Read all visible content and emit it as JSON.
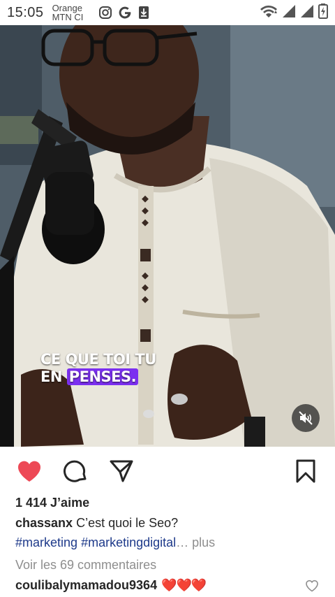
{
  "status_bar": {
    "time": "15:05",
    "carrier_line1": "Orange",
    "carrier_line2": "MTN CI"
  },
  "video": {
    "caption_line1": "CE QUE TOI TU",
    "caption_line2_prefix": "EN ",
    "caption_line2_highlight": "PENSES.",
    "highlight_color": "#7b2ff0",
    "muted": true
  },
  "post": {
    "liked": true,
    "like_color": "#ed4956",
    "likes_text": "1 414 J’aime",
    "username": "chassanx",
    "caption": "C’est quoi le Seo?",
    "hashtag1": "#marketing",
    "hashtag2": "#marketingdigital",
    "more_label": "… plus",
    "view_comments": "Voir les 69 commentaires",
    "comment_user": "coulibalymamadou9364",
    "comment_text": "❤️❤️❤️"
  }
}
